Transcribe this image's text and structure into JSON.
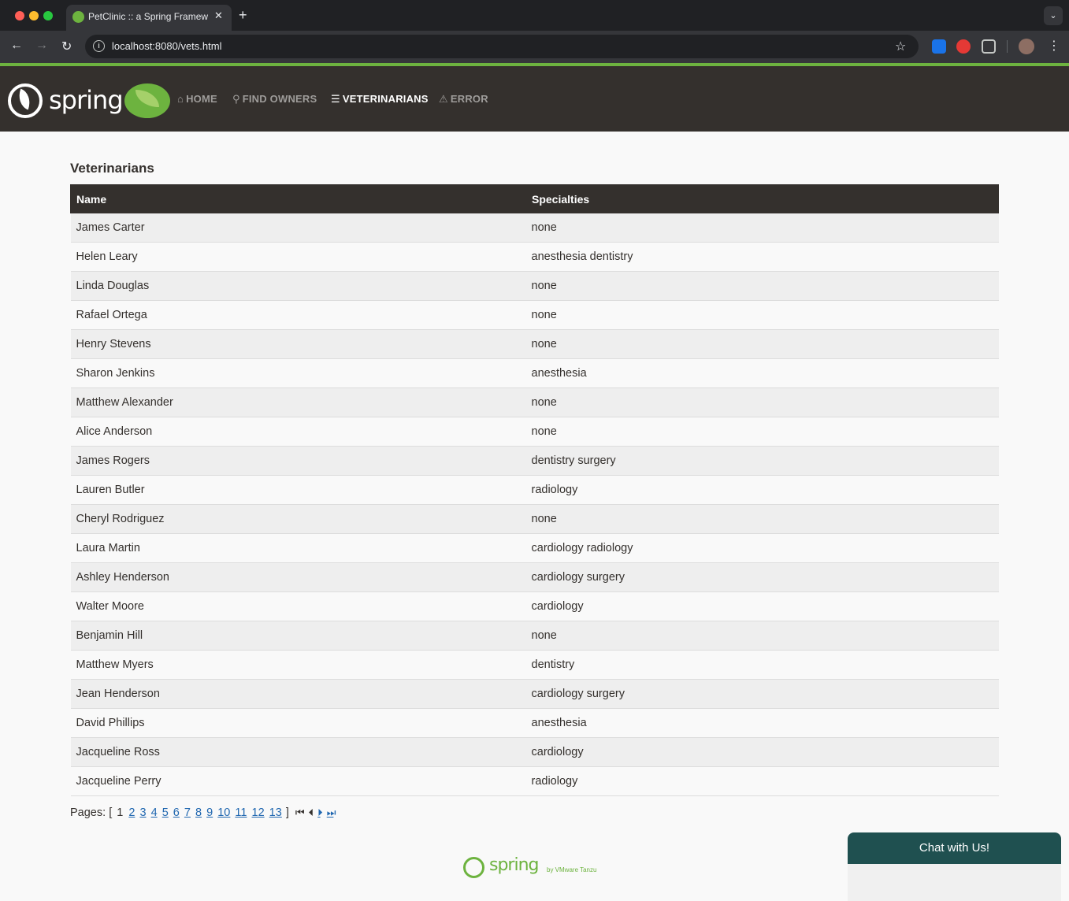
{
  "browser": {
    "tab_title": "PetClinic :: a Spring Framewo",
    "url": "localhost:8080/vets.html",
    "new_tab_label": "+",
    "close_tab_label": "✕"
  },
  "nav": {
    "logo_text": "spring",
    "items": [
      {
        "label": "HOME",
        "icon": "home-icon",
        "glyph": "⌂"
      },
      {
        "label": "FIND OWNERS",
        "icon": "search-icon",
        "glyph": "⚲"
      },
      {
        "label": "VETERINARIANS",
        "icon": "list-icon",
        "glyph": "☰"
      },
      {
        "label": "ERROR",
        "icon": "warning-icon",
        "glyph": "⚠"
      }
    ]
  },
  "page": {
    "heading": "Veterinarians",
    "columns": [
      "Name",
      "Specialties"
    ],
    "rows": [
      [
        "James Carter",
        "none"
      ],
      [
        "Helen Leary",
        "anesthesia dentistry"
      ],
      [
        "Linda Douglas",
        "none"
      ],
      [
        "Rafael Ortega",
        "none"
      ],
      [
        "Henry Stevens",
        "none"
      ],
      [
        "Sharon Jenkins",
        "anesthesia"
      ],
      [
        "Matthew Alexander",
        "none"
      ],
      [
        "Alice Anderson",
        "none"
      ],
      [
        "James Rogers",
        "dentistry surgery"
      ],
      [
        "Lauren Butler",
        "radiology"
      ],
      [
        "Cheryl Rodriguez",
        "none"
      ],
      [
        "Laura Martin",
        "cardiology radiology"
      ],
      [
        "Ashley Henderson",
        "cardiology surgery"
      ],
      [
        "Walter Moore",
        "cardiology"
      ],
      [
        "Benjamin Hill",
        "none"
      ],
      [
        "Matthew Myers",
        "dentistry"
      ],
      [
        "Jean Henderson",
        "cardiology surgery"
      ],
      [
        "David Phillips",
        "anesthesia"
      ],
      [
        "Jacqueline Ross",
        "cardiology"
      ],
      [
        "Jacqueline Perry",
        "radiology"
      ]
    ]
  },
  "pagination": {
    "label": "Pages:",
    "open_bracket": "[",
    "close_bracket": "]",
    "current": "1",
    "pages": [
      "2",
      "3",
      "4",
      "5",
      "6",
      "7",
      "8",
      "9",
      "10",
      "11",
      "12",
      "13"
    ],
    "first_glyph": "⏮",
    "prev_glyph": "⏴",
    "next_glyph": "⏵",
    "last_glyph": "⏭"
  },
  "footer": {
    "logo_text": "spring",
    "by_text": "by VMware Tanzu"
  },
  "chat": {
    "label": "Chat with Us!"
  },
  "colors": {
    "navbar": "#34302d",
    "accent": "#6db33f",
    "link": "#2067b0",
    "chat": "#1f5050"
  }
}
